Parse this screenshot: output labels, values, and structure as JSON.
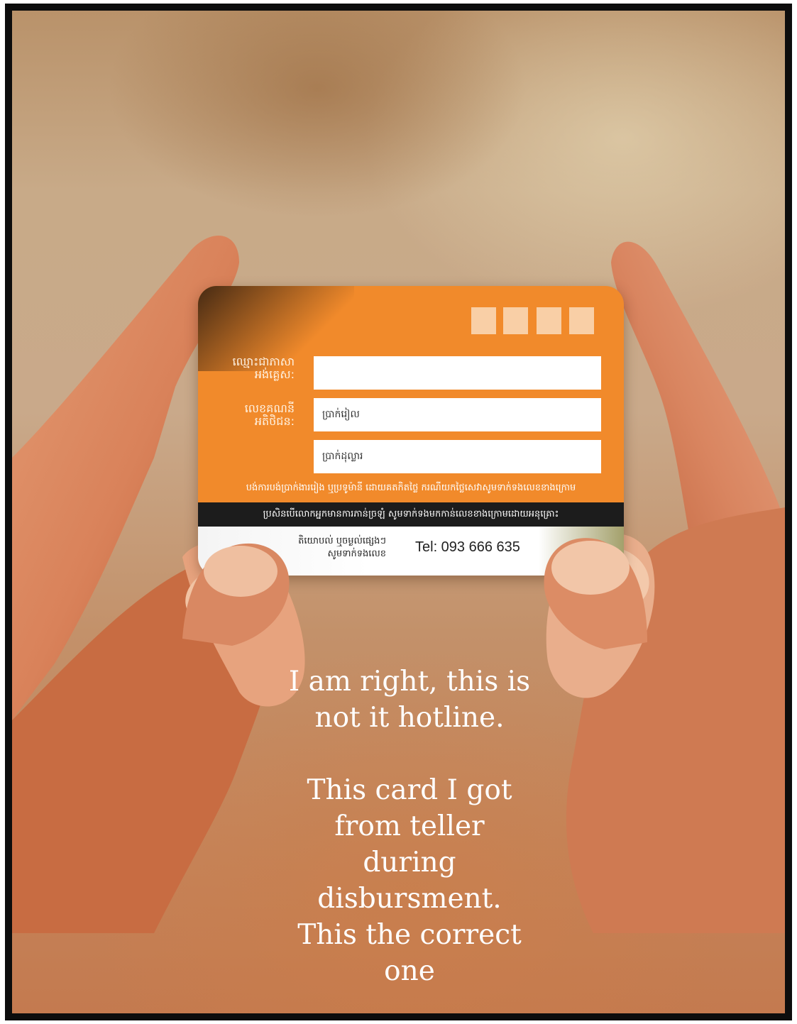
{
  "card": {
    "colors": {
      "orange": "#f18a2b",
      "chip": "#f9cfa6",
      "bar": "#1c1c1c"
    },
    "name_label_line1": "ឈ្មោះជាភាសា",
    "name_label_line2": "អង់គ្លេស:",
    "account_label_line1": "លេខគណនី",
    "account_label_line2": "អតិថិជន:",
    "field_riel": "ប្រាក់រៀល",
    "field_dollar": "ប្រាក់ដុល្លារ",
    "note": "បង់ការបង់ប្រាក់ងាររៀង ឬប្រទូម៉ានី ដោយគតកិតថ្លៃ ករណីយកថ្លៃសេវាសូមទាក់ទងលេខខាងក្រោម",
    "black_bar": "ប្រសិនបើលោកអ្នកមានការភាន់ច្រឡំ សូមទាក់ទងមកកាន់លេខខាងក្រោមដោយអនុគ្រោះ",
    "contact_line1": "តិយោបល់ ឬចម្ងល់ផ្សេងៗ",
    "contact_line2": "សូមទាក់ទងលេខ",
    "tel": "Tel: 093 666 635"
  },
  "caption": {
    "line1": "I am right, this is",
    "line2": "not it hotline.",
    "line3": "This card I got",
    "line4": "from teller",
    "line5": "during",
    "line6": "disbursment.",
    "line7": "This the correct",
    "line8": "one"
  }
}
